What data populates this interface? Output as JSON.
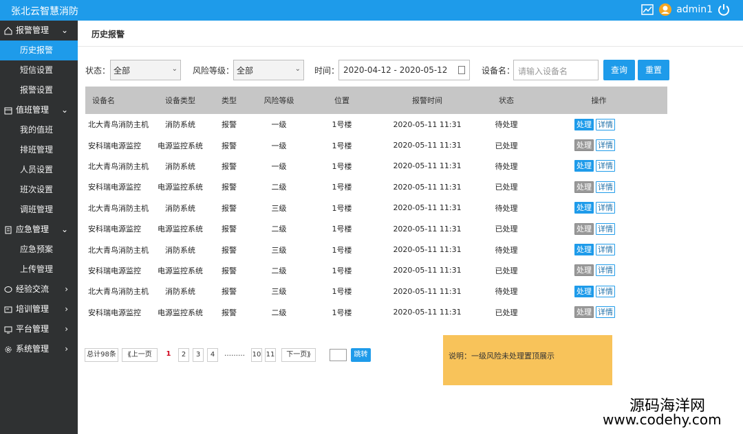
{
  "app": {
    "title": "张北云智慧消防",
    "user": "admin1"
  },
  "sidebar": {
    "groups": [
      {
        "label": "报警管理",
        "items": [
          "历史报警",
          "短信设置",
          "报警设置"
        ]
      },
      {
        "label": "值班管理",
        "items": [
          "我的值班",
          "排班管理",
          "人员设置",
          "班次设置",
          "调班管理"
        ]
      },
      {
        "label": "应急管理",
        "items": [
          "应急预案",
          "上传管理"
        ]
      },
      {
        "label": "经验交流",
        "items": []
      },
      {
        "label": "培训管理",
        "items": []
      },
      {
        "label": "平台管理",
        "items": []
      },
      {
        "label": "系统管理",
        "items": []
      }
    ],
    "active_item": "历史报警"
  },
  "page": {
    "title": "历史报警"
  },
  "filters": {
    "status_label": "状态：",
    "status_value": "全部",
    "risk_label": "风险等级：",
    "risk_value": "全部",
    "time_label": "时间：",
    "time_value": "2020-04-12 - 2020-05-12",
    "device_label": "设备名：",
    "device_placeholder": "请输入设备名",
    "query_button": "查询",
    "reset_button": "重置"
  },
  "table": {
    "headers": [
      "设备名",
      "设备类型",
      "类型",
      "风险等级",
      "位置",
      "报警时间",
      "状态",
      "操作"
    ],
    "rows": [
      [
        "北大青鸟消防主机",
        "消防系统",
        "报警",
        "一级",
        "1号楼",
        "2020-05-11 11:31",
        "待处理"
      ],
      [
        "安科瑞电源监控",
        "电源监控系统",
        "报警",
        "一级",
        "1号楼",
        "2020-05-11 11:31",
        "已处理"
      ],
      [
        "北大青鸟消防主机",
        "消防系统",
        "报警",
        "一级",
        "1号楼",
        "2020-05-11 11:31",
        "待处理"
      ],
      [
        "安科瑞电源监控",
        "电源监控系统",
        "报警",
        "二级",
        "1号楼",
        "2020-05-11 11:31",
        "已处理"
      ],
      [
        "北大青鸟消防主机",
        "消防系统",
        "报警",
        "三级",
        "1号楼",
        "2020-05-11 11:31",
        "待处理"
      ],
      [
        "安科瑞电源监控",
        "电源监控系统",
        "报警",
        "二级",
        "1号楼",
        "2020-05-11 11:31",
        "已处理"
      ],
      [
        "北大青鸟消防主机",
        "消防系统",
        "报警",
        "三级",
        "1号楼",
        "2020-05-11 11:31",
        "待处理"
      ],
      [
        "安科瑞电源监控",
        "电源监控系统",
        "报警",
        "二级",
        "1号楼",
        "2020-05-11 11:31",
        "已处理"
      ],
      [
        "北大青鸟消防主机",
        "消防系统",
        "报警",
        "三级",
        "1号楼",
        "2020-05-11 11:31",
        "待处理"
      ],
      [
        "安科瑞电源监控",
        "电源监控系统",
        "报警",
        "二级",
        "1号楼",
        "2020-05-11 11:31",
        "已处理"
      ]
    ],
    "process_label": "处理",
    "detail_label": "详情"
  },
  "pagination": {
    "total": "总计98条",
    "prev": "上一页",
    "pages": [
      "1",
      "2",
      "3",
      "4"
    ],
    "ellipsis": "………",
    "last_pages": [
      "10",
      "11"
    ],
    "next": "下一页",
    "jump": "跳转",
    "current": "1"
  },
  "note": "说明：一级风险未处理置顶展示",
  "watermark": {
    "name": "源码海洋网",
    "url": "www.codehy.com"
  },
  "colors": {
    "primary": "#1e9bea",
    "sidebar": "#2f3132",
    "note": "#f8c35a"
  }
}
